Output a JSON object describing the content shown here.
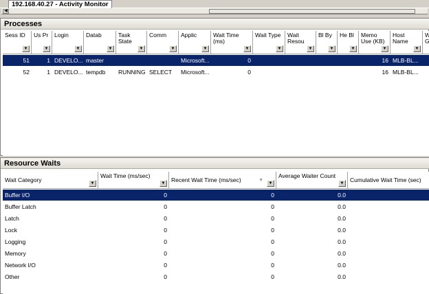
{
  "tab": {
    "title": "192.168.40.27 - Activity Monitor"
  },
  "processes": {
    "title": "Processes",
    "columns": [
      "Sess ID",
      "Us Pr",
      "Login",
      "Datab",
      "Task State",
      "Comm",
      "Applic",
      "Wait Time (ms)",
      "Wait Type",
      "Wait Resou",
      "Bl By",
      "He Bl",
      "Memo Use (KB)",
      "Host Name",
      "W G"
    ],
    "rows": [
      [
        "51",
        "1",
        "DEVELO...",
        "master",
        "",
        "",
        "Microsoft...",
        "0",
        "",
        "",
        "",
        "",
        "16",
        "MLB-BL..."
      ],
      [
        "52",
        "1",
        "DEVELO...",
        "tempdb",
        "RUNNING",
        "SELECT",
        "Microsoft...",
        "0",
        "",
        "",
        "",
        "",
        "16",
        "MLB-BL..."
      ]
    ]
  },
  "waits": {
    "title": "Resource Waits",
    "columns": [
      "Wait Category",
      "Wait Time (ms/sec)",
      "Recent Wait Time (ms/sec)",
      "Average Waiter Count",
      "Cumulative Wait Time (sec)"
    ],
    "rows": [
      [
        "Buffer I/O",
        "0",
        "0",
        "0.0"
      ],
      [
        "Buffer Latch",
        "0",
        "0",
        "0.0"
      ],
      [
        "Latch",
        "0",
        "0",
        "0.0"
      ],
      [
        "Lock",
        "0",
        "0",
        "0.0"
      ],
      [
        "Logging",
        "0",
        "0",
        "0.0"
      ],
      [
        "Memory",
        "0",
        "0",
        "0.0"
      ],
      [
        "Network I/O",
        "0",
        "0",
        "0.0"
      ],
      [
        "Other",
        "0",
        "0",
        "0.0"
      ]
    ]
  },
  "colors": {
    "selection": "#0a246a"
  }
}
